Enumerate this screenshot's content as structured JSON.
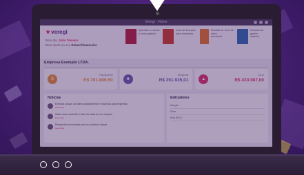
{
  "window": {
    "title": "Veregi - Home"
  },
  "header": {
    "logo_text": "veregi",
    "greeting_prefix": "Bom dia,",
    "user_name": "João Teixeira",
    "plan_prefix": "Bem-vindo ao seu",
    "plan_name": "Painel Financeiro"
  },
  "books": [
    {
      "title": "Aprenda a investir",
      "subtitle": "e-book gratuito",
      "color": "#b0203a"
    },
    {
      "title": "Guia de finanças",
      "subtitle": "para empresas",
      "color": "#c83a2a"
    },
    {
      "title": "Planilha de fluxo de caixa",
      "subtitle": "download",
      "color": "#e0722a"
    },
    {
      "title": "Controle de gastos",
      "subtitle": "material",
      "color": "#2a6ab0"
    }
  ],
  "company": {
    "name": "Empresa Exemplo LTDA."
  },
  "metrics": [
    {
      "label": "Faturamento",
      "value": "R$ 701.806,50",
      "icon": "coin-icon",
      "color": "#e08a3a"
    },
    {
      "label": "Despesas",
      "value": "R$ 351.935,01",
      "icon": "wallet-icon",
      "color": "#6a5aa8"
    },
    {
      "label": "Lucro",
      "value": "R$ 433.987,00",
      "icon": "chart-icon",
      "color": "#d6336c"
    }
  ],
  "news": {
    "title": "Notícias",
    "items": [
      {
        "text": "Entenda porque um ótimo planejamento é essencial para empresas",
        "meta": "Leia mais"
      },
      {
        "text": "Saiba como controlar o fluxo de caixa do seu negócio",
        "meta": "Leia mais"
      },
      {
        "text": "Perspectiva econômica para os próximos meses",
        "meta": "Leia mais"
      }
    ]
  },
  "indicators": {
    "title": "Indicadores",
    "items": [
      "Inflação",
      "Dólar",
      "Taxa SELIC"
    ]
  }
}
